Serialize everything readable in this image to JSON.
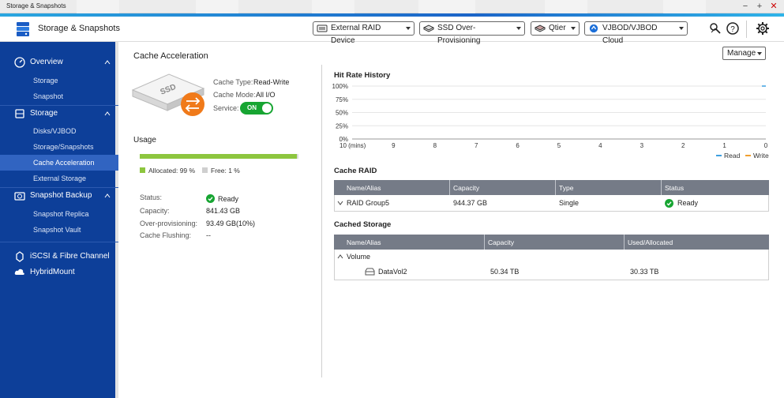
{
  "window": {
    "title": "Storage & Snapshots",
    "controls": [
      "minimize",
      "maximize",
      "close"
    ]
  },
  "header": {
    "app_title": "Storage & Snapshots",
    "buttons": [
      {
        "label": "External RAID Device"
      },
      {
        "label": "SSD Over-Provisioning"
      },
      {
        "label": "Qtier"
      },
      {
        "label": "VJBOD/VJBOD Cloud"
      }
    ]
  },
  "sidebar": {
    "sections": [
      {
        "label": "Overview",
        "items": [
          "Storage",
          "Snapshot"
        ]
      },
      {
        "label": "Storage",
        "items": [
          "Disks/VJBOD",
          "Storage/Snapshots",
          "Cache Acceleration",
          "External Storage"
        ]
      },
      {
        "label": "Snapshot Backup",
        "items": [
          "Snapshot Replica",
          "Snapshot Vault"
        ]
      },
      {
        "label": "iSCSI & Fibre Channel",
        "items": []
      },
      {
        "label": "HybridMount",
        "items": []
      }
    ],
    "active_item": "Cache Acceleration"
  },
  "cache": {
    "title": "Cache Acceleration",
    "ssd_label": "SSD",
    "cache_type_label": "Cache Type:",
    "cache_type_value": "Read-Write",
    "cache_mode_label": "Cache Mode:",
    "cache_mode_value": "All I/O",
    "service_label": "Service:",
    "service_value": "ON"
  },
  "usage": {
    "title": "Usage",
    "allocated_fraction": 0.99,
    "allocated_label": "Allocated: 99 %",
    "free_label": "Free: 1 %",
    "status_label": "Status:",
    "status_value": "Ready",
    "capacity_label": "Capacity:",
    "capacity_value": "841.43 GB",
    "overprov_label": "Over-provisioning:",
    "overprov_value": "93.49 GB(10%)",
    "flushing_label": "Cache Flushing:",
    "flushing_value": "--"
  },
  "manage": {
    "label": "Manage"
  },
  "chart_data": {
    "type": "line",
    "title": "Hit Rate History",
    "x": [
      "10 (mins)",
      "9",
      "8",
      "7",
      "6",
      "5",
      "4",
      "3",
      "2",
      "1",
      "0"
    ],
    "y_ticks": [
      "100%",
      "75%",
      "50%",
      "25%",
      "0%"
    ],
    "ylim": [
      0,
      100
    ],
    "grid": true,
    "legend": "bottom-right",
    "series": [
      {
        "name": "Read",
        "color": "#3ea0e0",
        "values": [
          null,
          null,
          null,
          null,
          null,
          null,
          null,
          null,
          null,
          null,
          100
        ]
      },
      {
        "name": "Write",
        "color": "#f0a030",
        "values": []
      }
    ]
  },
  "cache_raid": {
    "title": "Cache RAID",
    "columns": [
      "Name/Alias",
      "Capacity",
      "Type",
      "Status"
    ],
    "rows": [
      {
        "name": "RAID Group5",
        "capacity": "944.37 GB",
        "type": "Single",
        "status": "Ready"
      }
    ]
  },
  "cached_storage": {
    "title": "Cached Storage",
    "columns": [
      "Name/Alias",
      "Capacity",
      "Used/Allocated"
    ],
    "group": "Volume",
    "rows": [
      {
        "name": "DataVol2",
        "capacity": "50.34 TB",
        "used": "30.33 TB"
      }
    ]
  },
  "colors": {
    "sidebar": "#0d3f99",
    "active": "#3164c1",
    "accent": "#1b64c8",
    "ok": "#17a532",
    "allocated": "#8dc63f",
    "table_header": "#757b87"
  }
}
